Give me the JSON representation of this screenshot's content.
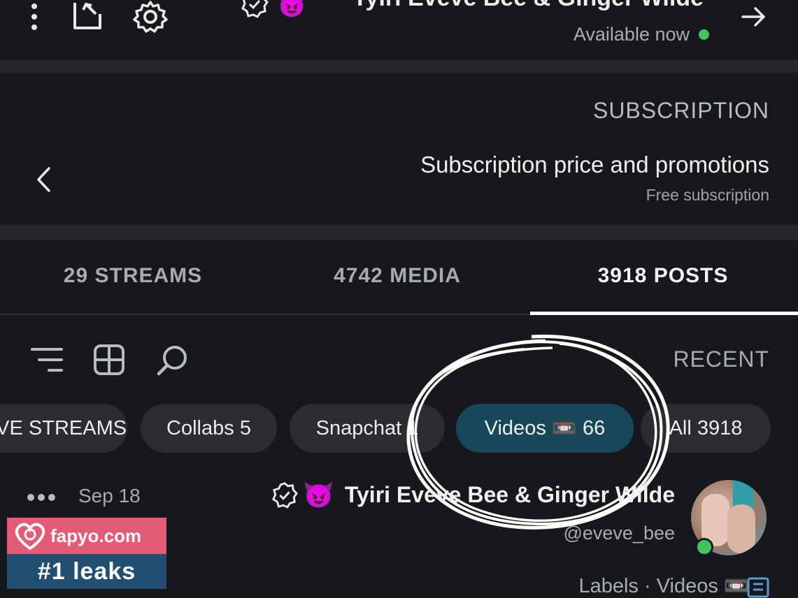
{
  "header": {
    "creator_name": "Tyiri Eveve Bee & Ginger Wilde",
    "status": "Available now",
    "status_color": "#3fc65a"
  },
  "subscription": {
    "section_label": "SUBSCRIPTION",
    "title": "Subscription price and promotions",
    "subtitle": "Free subscription"
  },
  "tabs": [
    {
      "label": "3918 POSTS"
    },
    {
      "label": "4742 MEDIA"
    },
    {
      "label": "29 STREAMS"
    }
  ],
  "filter": {
    "label": "RECENT"
  },
  "chips": [
    {
      "label": "All 3918"
    },
    {
      "label": "Videos 📼 66"
    },
    {
      "label": "Snapchat 1"
    },
    {
      "label": "Collabs 5"
    },
    {
      "label": "LIVE STREAMS"
    }
  ],
  "post": {
    "author": "Tyiri Eveve Bee & Ginger Wilde",
    "handle": "@eveve_bee",
    "date": "Sep 18",
    "labels_text": "Labels",
    "labels_value": "Videos 📼"
  },
  "watermark": {
    "site": "fapyo.com",
    "tagline": "#1 leaks"
  },
  "colors": {
    "background": "#17181b",
    "active_chip": "#17485a",
    "chip": "#2a2c30"
  }
}
